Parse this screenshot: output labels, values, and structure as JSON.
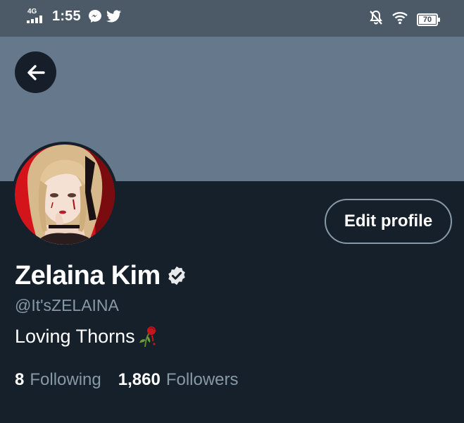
{
  "status_bar": {
    "network": "4G",
    "time": "1:55",
    "battery": "70"
  },
  "profile": {
    "display_name": "Zelaina Kim",
    "handle": "@It'sZELAINA",
    "bio": "Loving Thorns",
    "edit_button_label": "Edit profile"
  },
  "stats": {
    "following_count": "8",
    "following_label": "Following",
    "followers_count": "1,860",
    "followers_label": "Followers"
  },
  "colors": {
    "background": "#15202b",
    "banner": "#66788b",
    "status_bar": "#4c5a68",
    "secondary_text": "#8899a6",
    "avatar_accent": "#d3151b"
  },
  "icons": {
    "back": "arrow-left-icon",
    "verified": "verified-badge-icon",
    "bio_emoji": "wilted-rose-icon",
    "status_apps": [
      "messenger-icon",
      "twitter-bird-icon"
    ],
    "status_system": [
      "notifications-off-icon",
      "wifi-icon",
      "battery-icon"
    ]
  }
}
